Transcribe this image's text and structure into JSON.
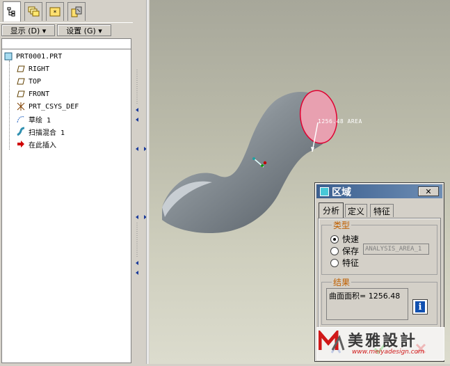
{
  "model_tree": {
    "tabs": [
      {
        "icon": "model-tree-icon"
      },
      {
        "icon": "layers-icon"
      },
      {
        "icon": "folder-browser-icon"
      },
      {
        "icon": "favorites-icon"
      }
    ],
    "show_button": "显示 (D) ▾",
    "settings_button": "设置 (G) ▾",
    "root": "PRT0001.PRT",
    "items": [
      {
        "label": "RIGHT",
        "icon": "datum-plane-icon"
      },
      {
        "label": "TOP",
        "icon": "datum-plane-icon"
      },
      {
        "label": "FRONT",
        "icon": "datum-plane-icon"
      },
      {
        "label": "PRT_CSYS_DEF",
        "icon": "coordinate-system-icon"
      },
      {
        "label": "草绘 1",
        "icon": "sketch-icon"
      },
      {
        "label": "扫描混合 1",
        "icon": "swept-blend-icon"
      },
      {
        "label": "在此插入",
        "icon": "insert-here-arrow-icon"
      }
    ]
  },
  "viewport": {
    "annotation": "1256.48 AREA"
  },
  "dialog": {
    "title": "区域",
    "close_label": "✕",
    "tabs": [
      "分析",
      "定义",
      "特征"
    ],
    "type_group_label": "类型",
    "options": [
      "快速",
      "保存",
      "特征"
    ],
    "selected_option": "快速",
    "save_name": "ANALYSIS_AREA_1",
    "result_group_label": "结果",
    "result_text": "曲面面积= 1256.48",
    "info_icon": "info-icon"
  },
  "watermark": {
    "text": "美雅設計",
    "url": "www.meiyadesign.com"
  },
  "colors": {
    "accent_title": "#3b5f8f",
    "group_label": "#c06000",
    "selected_surface": "#e8a0b0"
  }
}
